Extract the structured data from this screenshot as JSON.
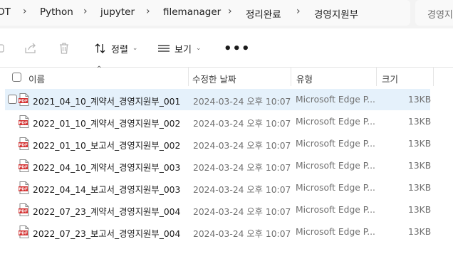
{
  "breadcrumb": {
    "items": [
      "OT",
      "Python",
      "jupyter",
      "filemanager",
      "정리완료",
      "경영지원부"
    ],
    "separator": "›"
  },
  "search": {
    "placeholder": "경영지"
  },
  "toolbar": {
    "sort_label": "정렬",
    "view_label": "보기",
    "more_label": "•••"
  },
  "columns": {
    "name": "이름",
    "modified": "수정한 날짜",
    "type": "유형",
    "size": "크기"
  },
  "files": [
    {
      "name": "2021_04_10_계약서_경영지원부_001",
      "modified": "2024-03-24 오후 10:07",
      "type": "Microsoft Edge P...",
      "size": "13KB",
      "selected": true
    },
    {
      "name": "2022_01_10_계약서_경영지원부_002",
      "modified": "2024-03-24 오후 10:07",
      "type": "Microsoft Edge P...",
      "size": "13KB"
    },
    {
      "name": "2022_01_10_보고서_경영지원부_002",
      "modified": "2024-03-24 오후 10:07",
      "type": "Microsoft Edge P...",
      "size": "13KB"
    },
    {
      "name": "2022_04_10_계약서_경영지원부_003",
      "modified": "2024-03-24 오후 10:07",
      "type": "Microsoft Edge P...",
      "size": "13KB"
    },
    {
      "name": "2022_04_14_보고서_경영지원부_003",
      "modified": "2024-03-24 오후 10:07",
      "type": "Microsoft Edge P...",
      "size": "13KB"
    },
    {
      "name": "2022_07_23_계약서_경영지원부_004",
      "modified": "2024-03-24 오후 10:07",
      "type": "Microsoft Edge P...",
      "size": "13KB"
    },
    {
      "name": "2022_07_23_보고서_경영지원부_004",
      "modified": "2024-03-24 오후 10:07",
      "type": "Microsoft Edge P...",
      "size": "13KB"
    }
  ],
  "icons": {
    "file": "pdf-file-icon",
    "pdf_badge": "PDF"
  },
  "colors": {
    "selection": "#e5f1fb",
    "pdf_red": "#d32f2f"
  }
}
